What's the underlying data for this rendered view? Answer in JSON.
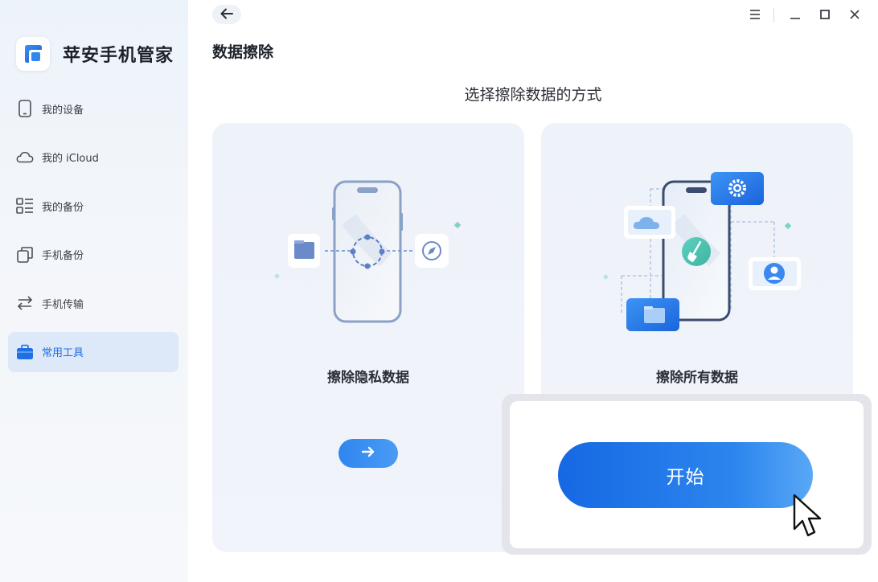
{
  "app": {
    "name": "苹安手机管家"
  },
  "sidebar": {
    "items": [
      {
        "label": "我的设备",
        "icon": "phone-icon"
      },
      {
        "label": "我的 iCloud",
        "icon": "cloud-icon"
      },
      {
        "label": "我的备份",
        "icon": "backup-list-icon"
      },
      {
        "label": "手机备份",
        "icon": "copy-icon"
      },
      {
        "label": "手机传输",
        "icon": "transfer-icon"
      },
      {
        "label": "常用工具",
        "icon": "toolbox-icon",
        "active": true
      }
    ]
  },
  "header": {
    "page_title": "数据擦除"
  },
  "main": {
    "subtitle": "选择擦除数据的方式",
    "cards": [
      {
        "title": "擦除隐私数据"
      },
      {
        "title": "擦除所有数据"
      }
    ]
  },
  "popup": {
    "start_label": "开始"
  },
  "colors": {
    "accent": "#1f6fe5",
    "button_gradient_start": "#1668e3",
    "button_gradient_end": "#59a8f6",
    "active_nav_bg": "#dde8f8"
  }
}
